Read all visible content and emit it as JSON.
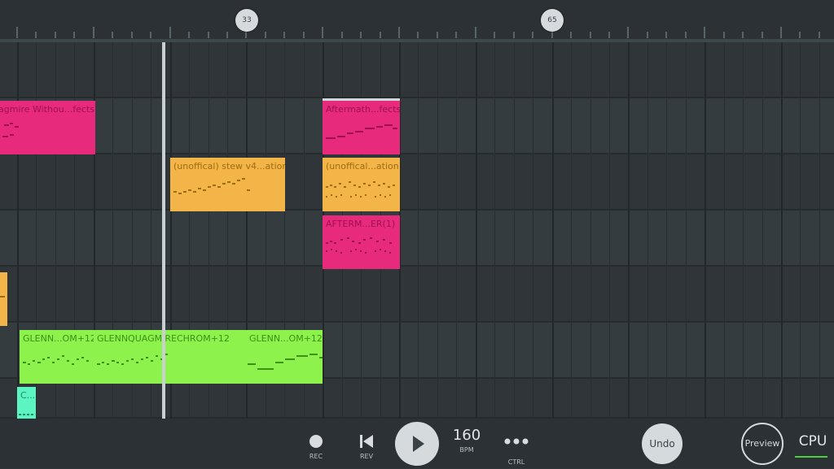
{
  "timeline": {
    "markers": [
      "33",
      "65"
    ]
  },
  "clips": {
    "c1": "agmire Withou...fects",
    "c2": "Aftermath...fects",
    "c3": "(unoffical) stew v4...ation",
    "c4": "(unoffical...ation",
    "c5": "AFTERM...ER(1)",
    "c6": "GLENN...OM+12",
    "c7": "GLENNQUAGMIRECHROM+12",
    "c8": "GLENN...OM+12",
    "c9": "C..."
  },
  "transport": {
    "rec_label": "REC",
    "rev_label": "REV",
    "bpm_value": "160",
    "bpm_label": "BPM",
    "ctrl_label": "CTRL",
    "undo_label": "Undo",
    "preview_label": "Preview",
    "cpu_label": "CPU"
  },
  "colors": {
    "pink": "#e82a7d",
    "orange": "#f4b548",
    "green": "#8df34c",
    "teal": "#5cf5c2",
    "background": "#2f3538"
  },
  "icons": [
    "record-icon",
    "rewind-icon",
    "play-icon",
    "more-dots-icon"
  ]
}
